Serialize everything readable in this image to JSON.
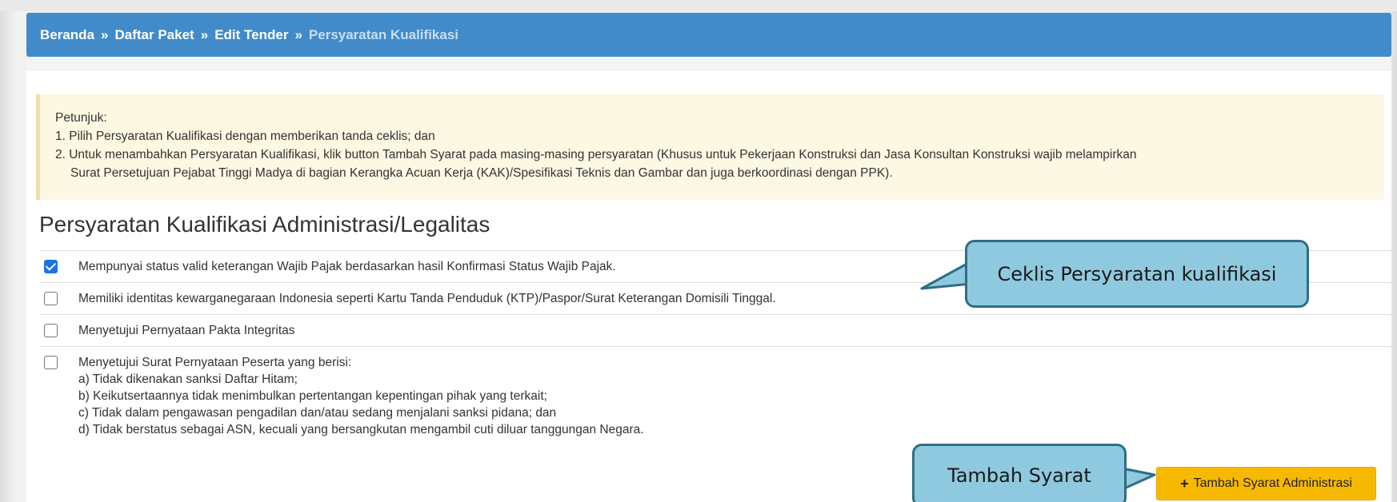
{
  "breadcrumb": {
    "items": [
      "Beranda",
      "Daftar Paket",
      "Edit Tender"
    ],
    "current": "Persyaratan Kualifikasi",
    "separator": "»"
  },
  "instructions": {
    "heading": "Petunjuk:",
    "line1": "1. Pilih Persyaratan Kualifikasi dengan memberikan tanda ceklis; dan",
    "line2a": "2. Untuk menambahkan Persyaratan Kualifikasi, klik button Tambah Syarat pada masing-masing persyaratan (Khusus untuk Pekerjaan Konstruksi dan Jasa Konsultan Konstruksi wajib melampirkan",
    "line2b": "Surat Persetujuan Pejabat Tinggi Madya di bagian Kerangka Acuan Kerja (KAK)/Spesifikasi Teknis dan Gambar dan juga berkoordinasi dengan PPK)."
  },
  "section": {
    "title": "Persyaratan Kualifikasi Administrasi/Legalitas",
    "requirements": [
      {
        "text": "Mempunyai status valid keterangan Wajib Pajak berdasarkan hasil Konfirmasi Status Wajib Pajak.",
        "checked": true
      },
      {
        "text": "Memiliki identitas kewarganegaraan Indonesia seperti Kartu Tanda Penduduk (KTP)/Paspor/Surat Keterangan Domisili Tinggal.",
        "checked": false
      },
      {
        "text": "Menyetujui Pernyataan Pakta Integritas",
        "checked": false
      },
      {
        "text": "Menyetujui Surat Pernyataan Peserta yang berisi:",
        "checked": false,
        "subitems": [
          "a) Tidak dikenakan sanksi Daftar Hitam;",
          "b) Keikutsertaannya tidak menimbulkan pertentangan kepentingan pihak yang terkait;",
          "c) Tidak dalam pengawasan pengadilan dan/atau sedang menjalani sanksi pidana; dan",
          "d) Tidak berstatus sebagai ASN, kecuali yang bersangkutan mengambil cuti diluar tanggungan Negara."
        ]
      }
    ]
  },
  "add_button": {
    "label": "Tambah Syarat Administrasi",
    "icon": "plus-icon"
  },
  "callouts": {
    "checklist": "Ceklis Persyaratan kualifikasi",
    "add": "Tambah Syarat"
  },
  "colors": {
    "breadcrumb_bg": "#428bca",
    "alert_bg": "#fcf8e3",
    "button_bg": "#f7b900",
    "callout_bg": "#8fc9df",
    "callout_border": "#2e6f86",
    "checkbox_checked": "#1a73e8"
  }
}
